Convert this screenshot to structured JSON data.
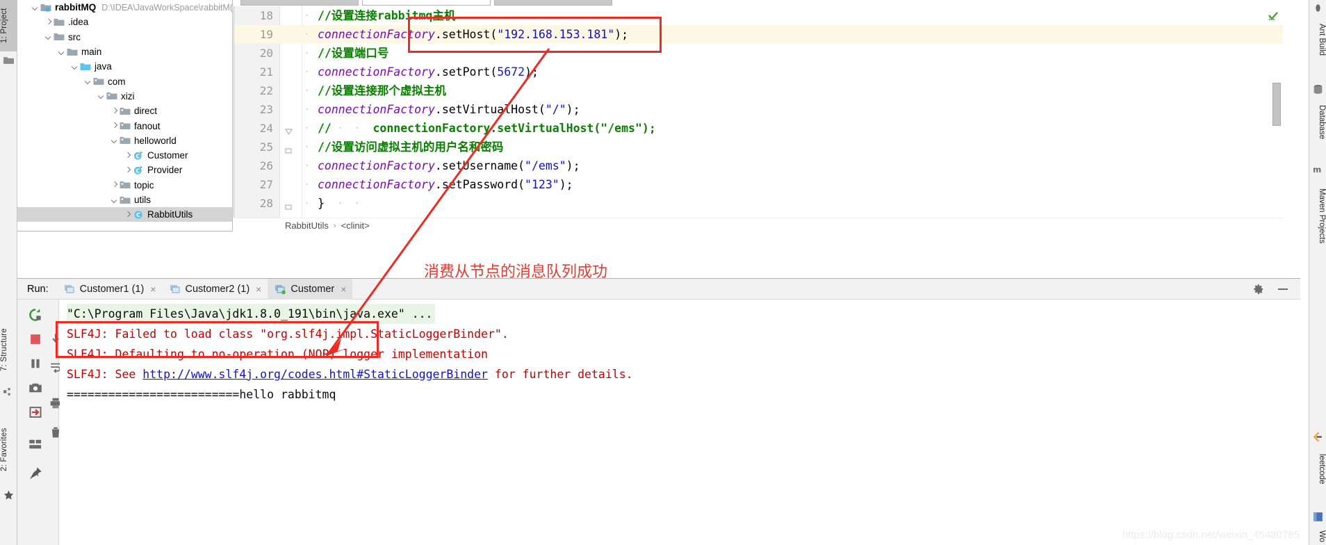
{
  "left_strip": {
    "tabs": [
      {
        "label": "1: Project",
        "icon": "project-folder-icon",
        "active": true
      },
      {
        "label": "7: Structure",
        "icon": "structure-icon",
        "active": false
      },
      {
        "label": "2: Favorites",
        "icon": "star-icon",
        "active": false
      }
    ]
  },
  "right_strip": {
    "tabs": [
      {
        "label": "Ant Build",
        "icon": "ant-build-icon"
      },
      {
        "label": "Database",
        "icon": "database-icon"
      },
      {
        "label": "Maven Projects",
        "icon": "maven-icon"
      },
      {
        "label": "leetcode",
        "icon": "leetcode-icon"
      },
      {
        "label": "Wo",
        "icon": "word-icon"
      }
    ]
  },
  "project_tree": {
    "root_name": "rabbitMQ",
    "root_path": "D:\\IDEA\\JavaWorkSpace\\rabbitM(",
    "items": [
      {
        "label": ".idea",
        "indent": 1,
        "arrow": "right",
        "icon": "folder-icon",
        "selected": false
      },
      {
        "label": "src",
        "indent": 1,
        "arrow": "down",
        "icon": "folder-icon",
        "selected": false
      },
      {
        "label": "main",
        "indent": 2,
        "arrow": "down",
        "icon": "folder-icon",
        "selected": false
      },
      {
        "label": "java",
        "indent": 3,
        "arrow": "down",
        "icon": "source-folder-icon",
        "selected": false
      },
      {
        "label": "com",
        "indent": 4,
        "arrow": "down",
        "icon": "package-icon",
        "selected": false
      },
      {
        "label": "xizi",
        "indent": 5,
        "arrow": "down",
        "icon": "package-icon",
        "selected": false
      },
      {
        "label": "direct",
        "indent": 6,
        "arrow": "right",
        "icon": "package-icon",
        "selected": false
      },
      {
        "label": "fanout",
        "indent": 6,
        "arrow": "right",
        "icon": "package-icon",
        "selected": false
      },
      {
        "label": "helloworld",
        "indent": 6,
        "arrow": "down",
        "icon": "package-icon",
        "selected": false
      },
      {
        "label": "Customer",
        "indent": 7,
        "arrow": "right",
        "icon": "java-class-run-icon",
        "selected": false
      },
      {
        "label": "Provider",
        "indent": 7,
        "arrow": "right",
        "icon": "java-class-run-icon",
        "selected": false
      },
      {
        "label": "topic",
        "indent": 6,
        "arrow": "right",
        "icon": "package-icon",
        "selected": false
      },
      {
        "label": "utils",
        "indent": 6,
        "arrow": "down",
        "icon": "package-icon",
        "selected": false
      },
      {
        "label": "RabbitUtils",
        "indent": 7,
        "arrow": "right",
        "icon": "java-class-icon",
        "selected": true
      }
    ]
  },
  "editor": {
    "lines": [
      {
        "num": "18",
        "highlight": false,
        "fold": "",
        "tokens": [
          {
            "t": "comment",
            "v": "//设置连接rabbitmq主机"
          }
        ]
      },
      {
        "num": "19",
        "highlight": true,
        "fold": "",
        "tokens": [
          {
            "t": "field",
            "v": "connectionFactory"
          },
          {
            "t": "plain",
            "v": ".setHost("
          },
          {
            "t": "string",
            "v": "\"192.168.153.181\""
          },
          {
            "t": "plain",
            "v": ");"
          }
        ]
      },
      {
        "num": "20",
        "highlight": false,
        "fold": "",
        "tokens": [
          {
            "t": "comment",
            "v": "//设置端口号"
          }
        ]
      },
      {
        "num": "21",
        "highlight": false,
        "fold": "",
        "tokens": [
          {
            "t": "field",
            "v": "connectionFactory"
          },
          {
            "t": "plain",
            "v": ".setPort("
          },
          {
            "t": "number",
            "v": "5672"
          },
          {
            "t": "plain",
            "v": ");"
          }
        ]
      },
      {
        "num": "22",
        "highlight": false,
        "fold": "",
        "tokens": [
          {
            "t": "comment",
            "v": "//设置连接那个虚拟主机"
          }
        ]
      },
      {
        "num": "23",
        "highlight": false,
        "fold": "",
        "tokens": [
          {
            "t": "field",
            "v": "connectionFactory"
          },
          {
            "t": "plain",
            "v": ".setVirtualHost("
          },
          {
            "t": "string",
            "v": "\"/\""
          },
          {
            "t": "plain",
            "v": ");"
          }
        ]
      },
      {
        "num": "24",
        "highlight": false,
        "fold": "collapse",
        "tokens": [
          {
            "t": "comment",
            "v": "//"
          },
          {
            "t": "plain",
            "v": "      "
          },
          {
            "t": "comment",
            "v": "connectionFactory.setVirtualHost(\"/ems\");"
          }
        ]
      },
      {
        "num": "25",
        "highlight": false,
        "fold": "end",
        "tokens": [
          {
            "t": "comment",
            "v": "//设置访问虚拟主机的用户名和密码"
          }
        ]
      },
      {
        "num": "26",
        "highlight": false,
        "fold": "",
        "tokens": [
          {
            "t": "field",
            "v": "connectionFactory"
          },
          {
            "t": "plain",
            "v": ".setUsername("
          },
          {
            "t": "string",
            "v": "\"/ems\""
          },
          {
            "t": "plain",
            "v": ");"
          }
        ]
      },
      {
        "num": "27",
        "highlight": false,
        "fold": "",
        "tokens": [
          {
            "t": "field",
            "v": "connectionFactory"
          },
          {
            "t": "plain",
            "v": ".setPassword("
          },
          {
            "t": "string",
            "v": "\"123\""
          },
          {
            "t": "plain",
            "v": ");"
          }
        ]
      },
      {
        "num": "28",
        "highlight": false,
        "fold": "end",
        "tokens": [
          {
            "t": "plain",
            "v": "}"
          }
        ]
      }
    ],
    "breadcrumb": [
      "RabbitUtils",
      "<clinit>"
    ],
    "breadcrumb_separator": "›",
    "inspection_icon": "inspection-ok-icon"
  },
  "annotation": {
    "text": "消费从节点的消息队列成功",
    "color": "#e8392f"
  },
  "run_panel": {
    "label": "Run:",
    "tabs": [
      {
        "label": "Customer1 (1)",
        "active": false,
        "close": "×",
        "icon": "run-tab-icon"
      },
      {
        "label": "Customer2 (1)",
        "active": false,
        "close": "×",
        "icon": "run-tab-icon"
      },
      {
        "label": "Customer",
        "active": true,
        "close": "×",
        "icon": "run-tab-active-icon"
      }
    ],
    "settings_icon": "gear-icon",
    "minimize_icon": "minimize-icon",
    "toolbar_icons": [
      "rerun-icon",
      "stop-icon",
      "pause-icon",
      "camera-icon",
      "export-icon",
      "layout-icon",
      "pin-icon"
    ],
    "console": [
      {
        "style": "cmd",
        "text": "\"C:\\Program Files\\Java\\jdk1.8.0_191\\bin\\java.exe\" ..."
      },
      {
        "style": "err",
        "text": "SLF4J: Failed to load class \"org.slf4j.impl.StaticLoggerBinder\"."
      },
      {
        "style": "err",
        "text": "SLF4J: Defaulting to no-operation (NOP) logger implementation"
      },
      {
        "style": "err-link",
        "prefix": "SLF4J: See ",
        "link": "http://www.slf4j.org/codes.html#StaticLoggerBinder",
        "suffix": " for further details."
      },
      {
        "style": "plain",
        "text": "=========================hello rabbitmq"
      }
    ]
  },
  "watermark": "https://blog.csdn.net/weixin_45480785"
}
